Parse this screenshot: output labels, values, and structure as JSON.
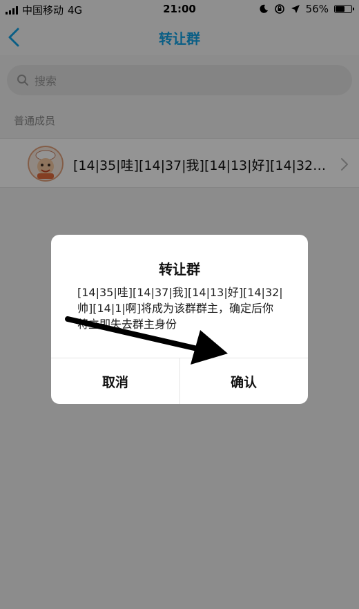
{
  "status_bar": {
    "carrier": "中国移动",
    "network": "4G",
    "time": "21:00",
    "battery": "56%",
    "battery_level": 0.56,
    "icons": [
      "signal-icon",
      "moon-icon",
      "orientation-lock-icon",
      "location-icon",
      "battery-icon"
    ]
  },
  "nav": {
    "title": "转让群",
    "back_icon": "back-chevron-icon"
  },
  "search": {
    "placeholder": "搜索"
  },
  "section": {
    "label": "普通成员"
  },
  "member": {
    "name": "[14|35|哇][14|37|我][14|13|好][14|32|帅][14|1|啊]",
    "chevron_icon": "chevron-right-icon"
  },
  "dialog": {
    "title": "转让群",
    "message": "[14|35|哇][14|37|我][14|13|好][14|32|帅][14|1|啊]将成为该群群主，确定后你将立即失去群主身份",
    "cancel_label": "取消",
    "confirm_label": "确认"
  },
  "colors": {
    "accent": "#12a3e6",
    "overlay": "rgba(0,0,0,0.42)",
    "annotation_arrow": "#000000"
  }
}
